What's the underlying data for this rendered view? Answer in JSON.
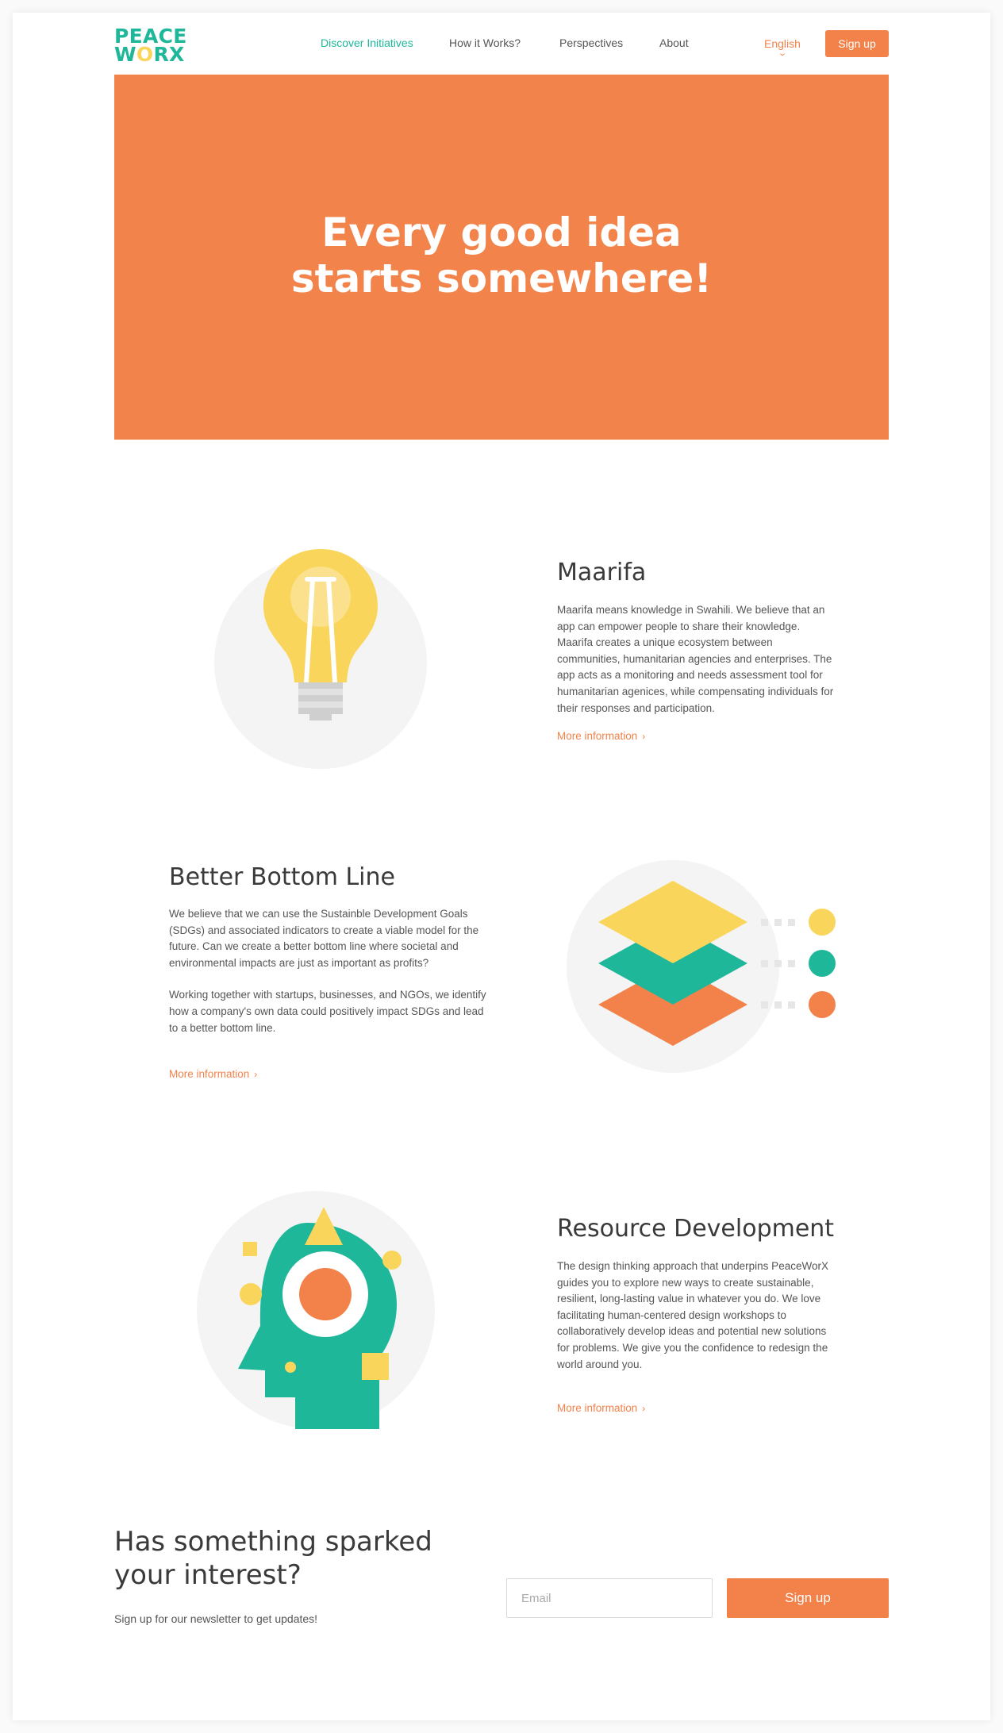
{
  "header": {
    "logo_line1": "PEACE",
    "logo_line2_a": "W",
    "logo_line2_b": "O",
    "logo_line2_c": "RX",
    "nav": {
      "discover": "Discover Initiatives",
      "how": "How it Works?",
      "perspectives": "Perspectives",
      "about": "About"
    },
    "language": "English",
    "signup": "Sign up"
  },
  "hero": {
    "line1": "Every good idea",
    "line2": "starts somewhere!"
  },
  "sections": [
    {
      "title": "Maarifa",
      "paragraphs": [
        "Maarifa means knowledge in Swahili. We believe that an app can empower people to share their knowledge. Maarifa creates a unique ecosystem between communities, humanitarian agencies and enterprises. The app acts as a monitoring and needs assessment tool for humanitarian agenices, while compensating individuals for their responses and participation."
      ],
      "link": "More information"
    },
    {
      "title": "Better Bottom Line",
      "paragraphs": [
        "We believe that we can use the Sustainble Development Goals (SDGs) and associated indicators to create a viable model for the future. Can we create a better bottom line where societal and environmental impacts are just as important as profits?",
        "Working together with startups, businesses, and NGOs, we identify how a company's own data could positively impact SDGs and lead to a better bottom line."
      ],
      "link": "More information"
    },
    {
      "title": "Resource Development",
      "paragraphs": [
        "The design thinking approach that underpins PeaceWorX guides you to explore new ways to create sustainable, resilient, long-lasting value in whatever you do. We love facilitating human-centered design workshops to collaboratively develop ideas and potential new solutions for problems. We give you the confidence to redesign the world around you."
      ],
      "link": "More information"
    }
  ],
  "newsletter": {
    "title_line1": "Has something sparked",
    "title_line2": "your interest?",
    "subtitle": "Sign up for our newsletter to get updates!",
    "email_placeholder": "Email",
    "button": "Sign up"
  },
  "icons": {
    "bulb": "lightbulb-icon",
    "layers": "layers-icon",
    "head": "head-idea-icon",
    "chevron": "chevron-right-icon",
    "lang_chevron": "chevron-down-icon"
  },
  "colors": {
    "accent": "#f2824a",
    "green": "#1fb79a",
    "yellow": "#f9d65b",
    "circle_bg": "#f4f4f4"
  }
}
